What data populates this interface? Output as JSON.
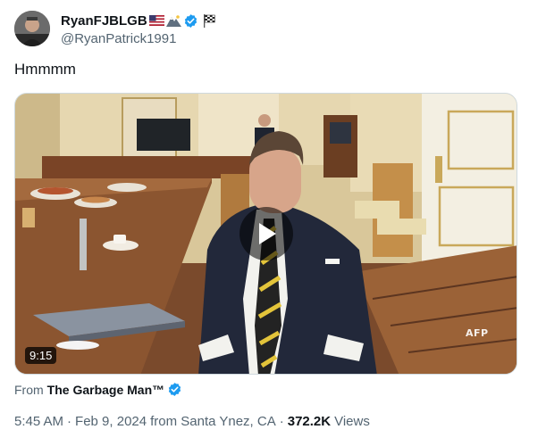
{
  "author": {
    "display_name": "RyanFJBLGB",
    "handle": "@RyanPatrick1991",
    "badge_icons": [
      "us-flag-icon",
      "mountain-icon",
      "verified-badge-icon",
      "checkered-flag-icon"
    ]
  },
  "tweet": {
    "text": "Hmmmm"
  },
  "media": {
    "duration": "9:15",
    "watermark": "AFP",
    "play_icon": "play-icon"
  },
  "attribution": {
    "prefix": "From",
    "source_name": "The Garbage Man™"
  },
  "meta": {
    "time": "5:45 AM",
    "date": "Feb 9, 2024",
    "location": "from Santa Ynez, CA",
    "views_count": "372.2K",
    "views_label": "Views"
  },
  "colors": {
    "verified_blue": "#1d9bf0",
    "muted_text": "#536471",
    "primary_text": "#0f1419"
  }
}
